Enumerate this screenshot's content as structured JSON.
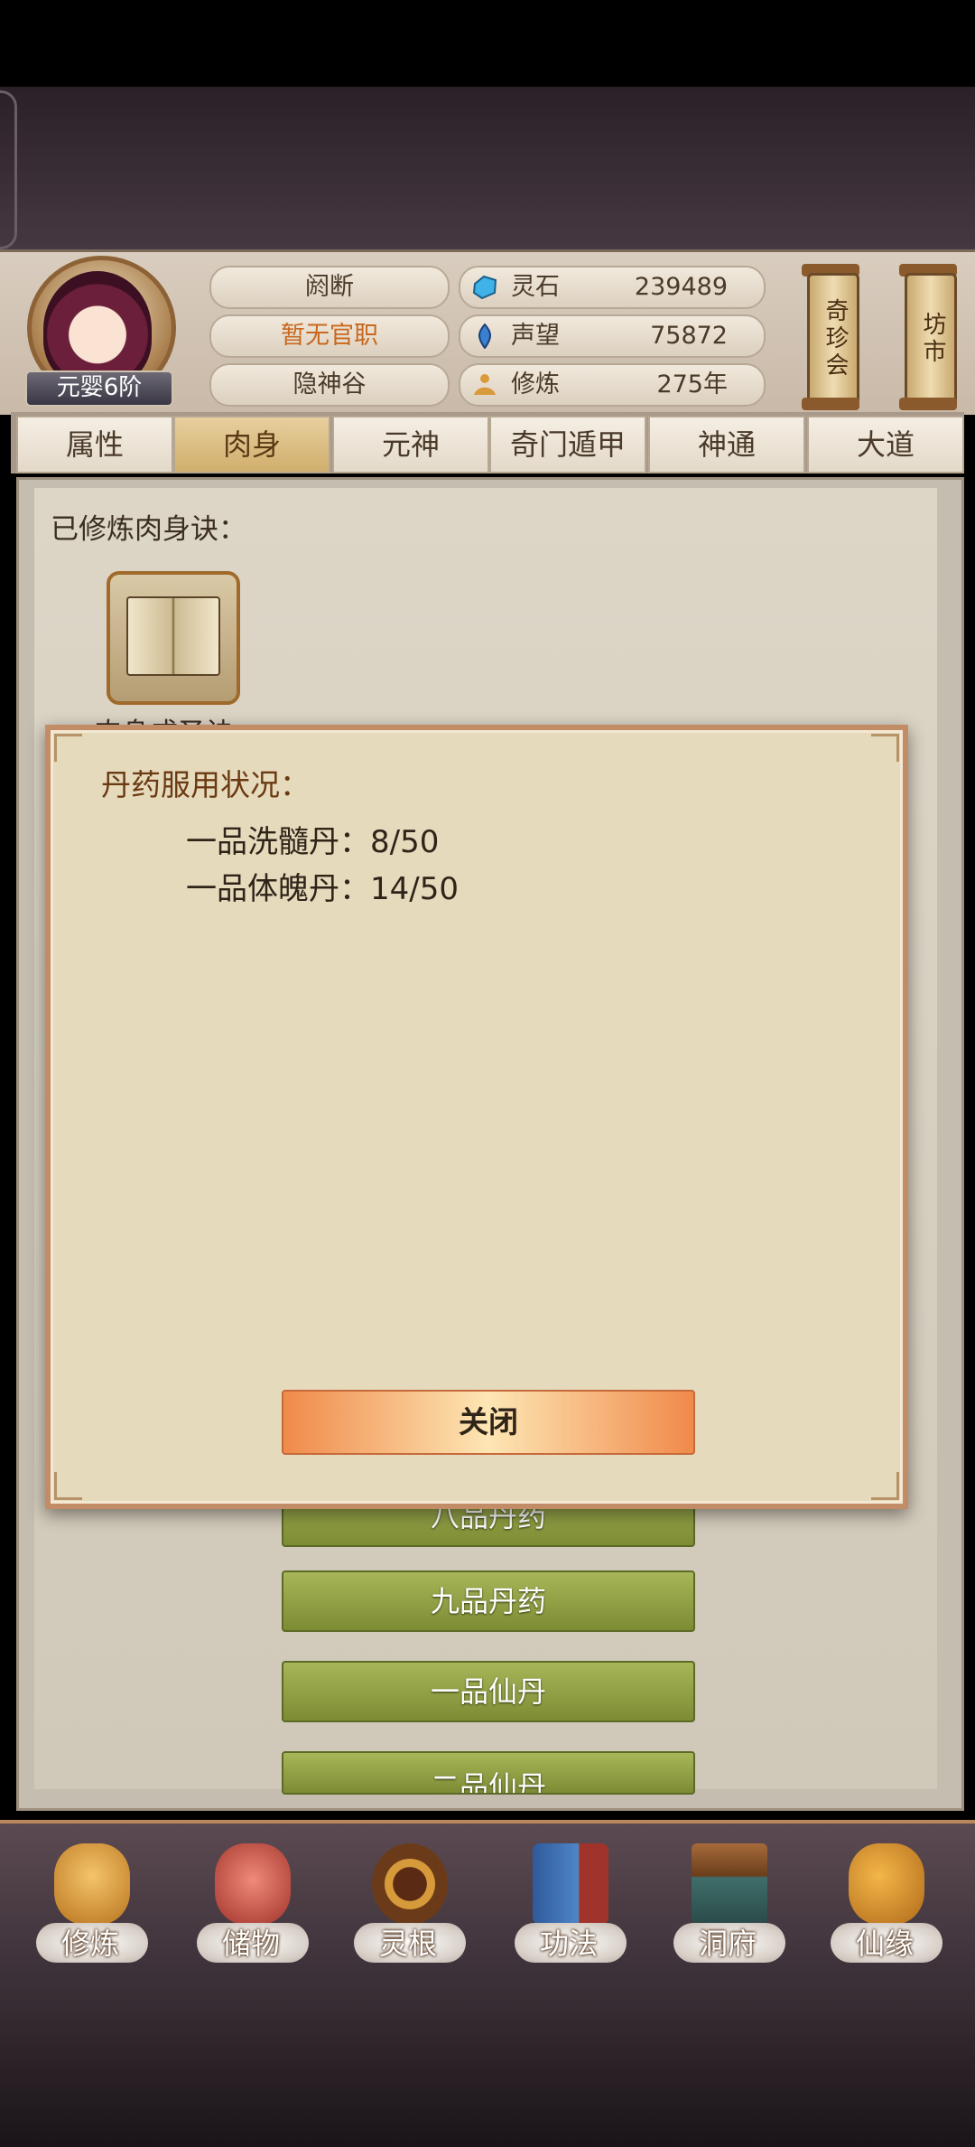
{
  "header": {
    "rank": "元婴6阶",
    "info": [
      "阏断",
      "暂无官职",
      "隐神谷"
    ],
    "resources": [
      {
        "label": "灵石",
        "value": "239489",
        "icon": "spirit-stone-icon"
      },
      {
        "label": "声望",
        "value": "75872",
        "icon": "prestige-icon"
      },
      {
        "label": "修炼",
        "value": "275年",
        "icon": "meditation-icon"
      }
    ],
    "shops": [
      "奇珍会",
      "坊市"
    ]
  },
  "tabs": [
    "属性",
    "肉身",
    "元神",
    "奇门遁甲",
    "神通",
    "大道"
  ],
  "active_tab": "肉身",
  "main": {
    "cultivated_label": "已修炼肉身诀：",
    "skill_name": "肉身成圣诀",
    "pill_buttons": [
      "八品丹药",
      "九品丹药",
      "一品仙丹",
      "二品仙丹"
    ]
  },
  "dialog": {
    "title": "丹药服用状况：",
    "rows": [
      {
        "name": "一品洗髓丹：",
        "value": "8/50"
      },
      {
        "name": "一品体魄丹：",
        "value": "14/50"
      }
    ],
    "close_label": "关闭"
  },
  "bottom_nav": [
    "修炼",
    "储物",
    "灵根",
    "功法",
    "洞府",
    "仙缘"
  ]
}
